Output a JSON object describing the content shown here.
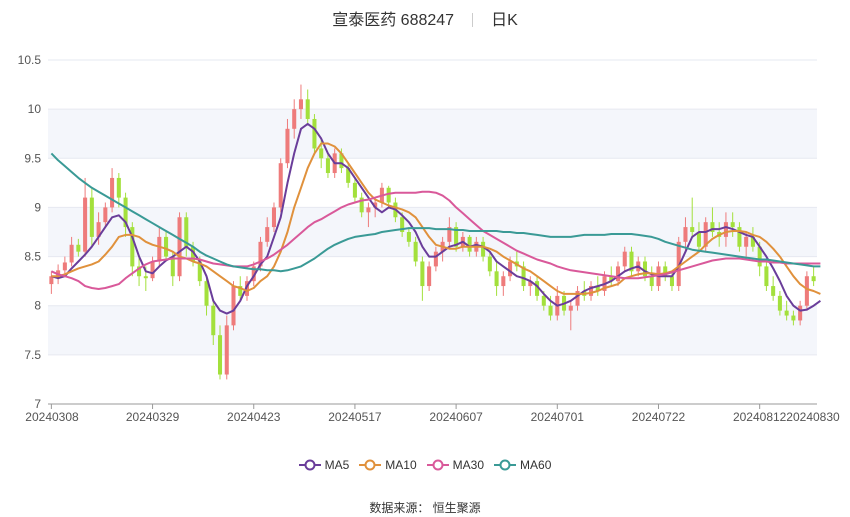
{
  "title": {
    "stock": "宣泰医药 688247",
    "period": "日K"
  },
  "source": "数据来源： 恒生聚源",
  "chart_data": {
    "type": "candlestick",
    "xlabels": [
      "20240308",
      "20240329",
      "20240423",
      "20240517",
      "20240607",
      "20240701",
      "20240722",
      "20240812",
      "20240830"
    ],
    "ylim": [
      7,
      10.5
    ],
    "yticks": [
      "7",
      "7.5",
      "8",
      "8.5",
      "9",
      "9.5",
      "10",
      "10.5"
    ],
    "grid": true,
    "legend_position": "bottom",
    "up_color": "#ee7b7b",
    "down_color": "#a3e03c",
    "dates": [
      "20240308",
      "20240311",
      "20240312",
      "20240313",
      "20240314",
      "20240315",
      "20240318",
      "20240319",
      "20240320",
      "20240321",
      "20240322",
      "20240325",
      "20240326",
      "20240327",
      "20240328",
      "20240329",
      "20240401",
      "20240402",
      "20240403",
      "20240408",
      "20240409",
      "20240410",
      "20240411",
      "20240412",
      "20240415",
      "20240416",
      "20240417",
      "20240418",
      "20240419",
      "20240422",
      "20240423",
      "20240424",
      "20240425",
      "20240426",
      "20240429",
      "20240430",
      "20240506",
      "20240507",
      "20240508",
      "20240509",
      "20240510",
      "20240513",
      "20240514",
      "20240515",
      "20240516",
      "20240517",
      "20240520",
      "20240521",
      "20240522",
      "20240523",
      "20240524",
      "20240527",
      "20240528",
      "20240529",
      "20240530",
      "20240531",
      "20240603",
      "20240604",
      "20240605",
      "20240606",
      "20240607",
      "20240611",
      "20240612",
      "20240613",
      "20240614",
      "20240617",
      "20240618",
      "20240619",
      "20240620",
      "20240621",
      "20240624",
      "20240625",
      "20240626",
      "20240627",
      "20240628",
      "20240701",
      "20240702",
      "20240703",
      "20240704",
      "20240705",
      "20240708",
      "20240709",
      "20240710",
      "20240711",
      "20240712",
      "20240715",
      "20240716",
      "20240717",
      "20240718",
      "20240719",
      "20240722",
      "20240723",
      "20240724",
      "20240725",
      "20240726",
      "20240729",
      "20240730",
      "20240731",
      "20240801",
      "20240802",
      "20240805",
      "20240806",
      "20240807",
      "20240808",
      "20240809",
      "20240812",
      "20240813",
      "20240814",
      "20240815",
      "20240816",
      "20240819",
      "20240820",
      "20240821",
      "20240822",
      "20240823",
      "20240826",
      "20240827",
      "20240828",
      "20240829",
      "20240830"
    ],
    "ohlc": [
      [
        8.22,
        8.35,
        8.12,
        8.3
      ],
      [
        8.3,
        8.42,
        8.22,
        8.36
      ],
      [
        8.36,
        8.5,
        8.3,
        8.44
      ],
      [
        8.44,
        8.7,
        8.4,
        8.62
      ],
      [
        8.62,
        8.68,
        8.5,
        8.55
      ],
      [
        8.55,
        9.3,
        8.5,
        9.1
      ],
      [
        9.1,
        9.2,
        8.6,
        8.7
      ],
      [
        8.7,
        8.95,
        8.62,
        8.85
      ],
      [
        8.85,
        9.05,
        8.8,
        9.0
      ],
      [
        9.0,
        9.4,
        8.95,
        9.3
      ],
      [
        9.3,
        9.35,
        9.0,
        9.1
      ],
      [
        9.1,
        9.15,
        8.7,
        8.8
      ],
      [
        8.8,
        8.85,
        8.3,
        8.4
      ],
      [
        8.4,
        8.5,
        8.2,
        8.3
      ],
      [
        8.3,
        8.4,
        8.15,
        8.28
      ],
      [
        8.28,
        8.5,
        8.25,
        8.45
      ],
      [
        8.45,
        8.8,
        8.4,
        8.7
      ],
      [
        8.7,
        8.75,
        8.45,
        8.5
      ],
      [
        8.5,
        8.55,
        8.2,
        8.3
      ],
      [
        8.3,
        8.95,
        8.25,
        8.9
      ],
      [
        8.9,
        8.95,
        8.5,
        8.6
      ],
      [
        8.6,
        8.65,
        8.4,
        8.45
      ],
      [
        8.45,
        8.5,
        8.2,
        8.25
      ],
      [
        8.25,
        8.3,
        7.9,
        8.0
      ],
      [
        8.0,
        8.05,
        7.6,
        7.7
      ],
      [
        7.7,
        7.8,
        7.25,
        7.3
      ],
      [
        7.3,
        7.9,
        7.25,
        7.8
      ],
      [
        7.8,
        8.25,
        7.75,
        8.2
      ],
      [
        8.2,
        8.3,
        8.05,
        8.1
      ],
      [
        8.1,
        8.3,
        8.05,
        8.25
      ],
      [
        8.25,
        8.45,
        8.2,
        8.4
      ],
      [
        8.4,
        8.7,
        8.35,
        8.65
      ],
      [
        8.65,
        8.9,
        8.6,
        8.8
      ],
      [
        8.8,
        9.05,
        8.75,
        9.0
      ],
      [
        9.0,
        9.5,
        8.95,
        9.45
      ],
      [
        9.45,
        9.9,
        9.4,
        9.8
      ],
      [
        9.8,
        10.1,
        9.7,
        10.0
      ],
      [
        10.0,
        10.25,
        9.9,
        10.1
      ],
      [
        10.1,
        10.2,
        9.85,
        9.9
      ],
      [
        9.9,
        9.95,
        9.55,
        9.6
      ],
      [
        9.6,
        9.7,
        9.4,
        9.5
      ],
      [
        9.5,
        9.55,
        9.3,
        9.35
      ],
      [
        9.35,
        9.6,
        9.3,
        9.55
      ],
      [
        9.55,
        9.6,
        9.35,
        9.4
      ],
      [
        9.4,
        9.45,
        9.2,
        9.25
      ],
      [
        9.25,
        9.3,
        9.05,
        9.1
      ],
      [
        9.1,
        9.15,
        8.9,
        8.95
      ],
      [
        8.95,
        9.05,
        8.8,
        9.0
      ],
      [
        9.0,
        9.1,
        8.9,
        9.05
      ],
      [
        9.05,
        9.25,
        9.0,
        9.2
      ],
      [
        9.2,
        9.22,
        9.0,
        9.05
      ],
      [
        9.05,
        9.1,
        8.85,
        8.9
      ],
      [
        8.9,
        8.95,
        8.7,
        8.75
      ],
      [
        8.75,
        8.8,
        8.6,
        8.65
      ],
      [
        8.65,
        8.7,
        8.4,
        8.45
      ],
      [
        8.45,
        8.5,
        8.05,
        8.2
      ],
      [
        8.2,
        8.45,
        8.15,
        8.4
      ],
      [
        8.4,
        8.6,
        8.35,
        8.55
      ],
      [
        8.55,
        8.7,
        8.45,
        8.65
      ],
      [
        8.65,
        8.9,
        8.6,
        8.8
      ],
      [
        8.8,
        8.85,
        8.55,
        8.6
      ],
      [
        8.6,
        8.75,
        8.55,
        8.7
      ],
      [
        8.7,
        8.72,
        8.5,
        8.55
      ],
      [
        8.55,
        8.7,
        8.5,
        8.65
      ],
      [
        8.65,
        8.7,
        8.45,
        8.5
      ],
      [
        8.5,
        8.55,
        8.3,
        8.35
      ],
      [
        8.35,
        8.45,
        8.1,
        8.2
      ],
      [
        8.2,
        8.35,
        8.1,
        8.3
      ],
      [
        8.3,
        8.5,
        8.25,
        8.45
      ],
      [
        8.45,
        8.55,
        8.35,
        8.4
      ],
      [
        8.4,
        8.45,
        8.15,
        8.2
      ],
      [
        8.2,
        8.3,
        8.1,
        8.25
      ],
      [
        8.25,
        8.3,
        8.05,
        8.1
      ],
      [
        8.1,
        8.15,
        7.95,
        8.0
      ],
      [
        8.0,
        8.1,
        7.85,
        7.9
      ],
      [
        7.9,
        8.2,
        7.85,
        8.1
      ],
      [
        8.1,
        8.15,
        7.9,
        7.95
      ],
      [
        7.95,
        8.05,
        7.75,
        8.0
      ],
      [
        8.0,
        8.2,
        7.95,
        8.15
      ],
      [
        8.15,
        8.25,
        8.05,
        8.1
      ],
      [
        8.1,
        8.25,
        8.05,
        8.2
      ],
      [
        8.2,
        8.3,
        8.1,
        8.15
      ],
      [
        8.15,
        8.35,
        8.1,
        8.3
      ],
      [
        8.3,
        8.4,
        8.2,
        8.25
      ],
      [
        8.25,
        8.45,
        8.2,
        8.4
      ],
      [
        8.4,
        8.6,
        8.35,
        8.55
      ],
      [
        8.55,
        8.6,
        8.3,
        8.35
      ],
      [
        8.35,
        8.5,
        8.3,
        8.45
      ],
      [
        8.45,
        8.5,
        8.25,
        8.3
      ],
      [
        8.3,
        8.4,
        8.15,
        8.2
      ],
      [
        8.2,
        8.45,
        8.15,
        8.4
      ],
      [
        8.4,
        8.45,
        8.25,
        8.3
      ],
      [
        8.3,
        8.35,
        8.15,
        8.2
      ],
      [
        8.2,
        8.7,
        8.15,
        8.65
      ],
      [
        8.65,
        8.9,
        8.55,
        8.8
      ],
      [
        8.8,
        9.1,
        8.7,
        8.75
      ],
      [
        8.75,
        8.85,
        8.55,
        8.6
      ],
      [
        8.6,
        8.9,
        8.55,
        8.85
      ],
      [
        8.85,
        9.0,
        8.7,
        8.75
      ],
      [
        8.75,
        8.85,
        8.6,
        8.7
      ],
      [
        8.7,
        8.95,
        8.6,
        8.85
      ],
      [
        8.85,
        8.95,
        8.7,
        8.8
      ],
      [
        8.8,
        8.85,
        8.55,
        8.6
      ],
      [
        8.6,
        8.75,
        8.5,
        8.7
      ],
      [
        8.7,
        8.8,
        8.55,
        8.6
      ],
      [
        8.6,
        8.65,
        8.3,
        8.4
      ],
      [
        8.4,
        8.45,
        8.15,
        8.2
      ],
      [
        8.2,
        8.3,
        8.05,
        8.1
      ],
      [
        8.1,
        8.15,
        7.9,
        7.95
      ],
      [
        7.95,
        8.05,
        7.85,
        7.9
      ],
      [
        7.9,
        7.95,
        7.8,
        7.85
      ],
      [
        7.85,
        8.05,
        7.8,
        8.0
      ],
      [
        8.0,
        8.35,
        7.95,
        8.3
      ],
      [
        8.3,
        8.4,
        8.2,
        8.25
      ]
    ],
    "series": [
      {
        "name": "MA5",
        "color": "#6a3d9a",
        "values": [
          8.3,
          8.28,
          8.3,
          8.38,
          8.45,
          8.52,
          8.6,
          8.7,
          8.8,
          8.9,
          8.92,
          8.85,
          8.7,
          8.5,
          8.35,
          8.33,
          8.4,
          8.46,
          8.5,
          8.55,
          8.6,
          8.55,
          8.45,
          8.3,
          8.05,
          7.95,
          7.92,
          7.95,
          8.05,
          8.2,
          8.3,
          8.42,
          8.5,
          8.7,
          8.9,
          9.25,
          9.55,
          9.8,
          9.85,
          9.8,
          9.7,
          9.55,
          9.45,
          9.45,
          9.4,
          9.3,
          9.2,
          9.1,
          9.0,
          8.95,
          9.0,
          8.98,
          8.92,
          8.85,
          8.75,
          8.6,
          8.5,
          8.5,
          8.55,
          8.6,
          8.62,
          8.65,
          8.6,
          8.62,
          8.6,
          8.55,
          8.45,
          8.4,
          8.35,
          8.3,
          8.28,
          8.25,
          8.2,
          8.12,
          8.05,
          8.0,
          8.02,
          8.05,
          8.1,
          8.15,
          8.18,
          8.2,
          8.22,
          8.25,
          8.3,
          8.35,
          8.38,
          8.4,
          8.35,
          8.32,
          8.3,
          8.3,
          8.3,
          8.4,
          8.55,
          8.7,
          8.75,
          8.75,
          8.78,
          8.78,
          8.8,
          8.78,
          8.75,
          8.72,
          8.7,
          8.6,
          8.5,
          8.38,
          8.25,
          8.1,
          8.0,
          7.95,
          7.96,
          8.0,
          8.05
        ]
      },
      {
        "name": "MA10",
        "color": "#e0913c",
        "values": [
          8.3,
          8.3,
          8.32,
          8.35,
          8.38,
          8.4,
          8.42,
          8.45,
          8.52,
          8.6,
          8.7,
          8.72,
          8.72,
          8.7,
          8.65,
          8.62,
          8.6,
          8.58,
          8.55,
          8.5,
          8.48,
          8.45,
          8.43,
          8.4,
          8.35,
          8.3,
          8.25,
          8.2,
          8.18,
          8.15,
          8.18,
          8.25,
          8.3,
          8.4,
          8.55,
          8.75,
          9.0,
          9.2,
          9.4,
          9.55,
          9.65,
          9.65,
          9.62,
          9.55,
          9.45,
          9.35,
          9.25,
          9.15,
          9.08,
          9.05,
          9.02,
          9.0,
          8.98,
          8.95,
          8.9,
          8.8,
          8.7,
          8.62,
          8.6,
          8.58,
          8.58,
          8.6,
          8.6,
          8.6,
          8.6,
          8.58,
          8.55,
          8.5,
          8.46,
          8.42,
          8.38,
          8.35,
          8.3,
          8.25,
          8.2,
          8.15,
          8.12,
          8.12,
          8.12,
          8.12,
          8.13,
          8.15,
          8.18,
          8.2,
          8.22,
          8.28,
          8.3,
          8.32,
          8.33,
          8.33,
          8.32,
          8.33,
          8.35,
          8.4,
          8.45,
          8.5,
          8.55,
          8.62,
          8.68,
          8.72,
          8.75,
          8.76,
          8.76,
          8.75,
          8.72,
          8.7,
          8.65,
          8.58,
          8.5,
          8.4,
          8.3,
          8.22,
          8.17,
          8.15,
          8.12
        ]
      },
      {
        "name": "MA30",
        "color": "#d9599a",
        "values": [
          8.35,
          8.32,
          8.3,
          8.28,
          8.25,
          8.2,
          8.18,
          8.17,
          8.18,
          8.2,
          8.22,
          8.28,
          8.33,
          8.38,
          8.42,
          8.45,
          8.46,
          8.47,
          8.48,
          8.48,
          8.48,
          8.48,
          8.47,
          8.45,
          8.43,
          8.42,
          8.41,
          8.4,
          8.4,
          8.4,
          8.42,
          8.45,
          8.48,
          8.52,
          8.57,
          8.62,
          8.68,
          8.74,
          8.8,
          8.85,
          8.88,
          8.92,
          8.96,
          9.0,
          9.03,
          9.05,
          9.07,
          9.08,
          9.1,
          9.12,
          9.14,
          9.15,
          9.15,
          9.15,
          9.15,
          9.16,
          9.16,
          9.15,
          9.12,
          9.07,
          9.0,
          8.94,
          8.88,
          8.82,
          8.76,
          8.72,
          8.68,
          8.64,
          8.6,
          8.56,
          8.53,
          8.5,
          8.47,
          8.45,
          8.43,
          8.4,
          8.38,
          8.36,
          8.35,
          8.34,
          8.33,
          8.32,
          8.31,
          8.3,
          8.29,
          8.28,
          8.28,
          8.28,
          8.29,
          8.3,
          8.31,
          8.32,
          8.34,
          8.36,
          8.38,
          8.4,
          8.42,
          8.44,
          8.46,
          8.47,
          8.48,
          8.48,
          8.48,
          8.47,
          8.46,
          8.45,
          8.45,
          8.44,
          8.44,
          8.43,
          8.43,
          8.43,
          8.43,
          8.43,
          8.43
        ]
      },
      {
        "name": "MA60",
        "color": "#3a9a96",
        "values": [
          9.55,
          9.48,
          9.42,
          9.36,
          9.3,
          9.25,
          9.2,
          9.16,
          9.12,
          9.08,
          9.04,
          9.0,
          8.96,
          8.92,
          8.88,
          8.84,
          8.8,
          8.76,
          8.72,
          8.68,
          8.64,
          8.6,
          8.55,
          8.51,
          8.48,
          8.45,
          8.42,
          8.4,
          8.39,
          8.38,
          8.37,
          8.37,
          8.36,
          8.36,
          8.35,
          8.36,
          8.38,
          8.4,
          8.44,
          8.48,
          8.53,
          8.58,
          8.62,
          8.65,
          8.68,
          8.7,
          8.71,
          8.72,
          8.73,
          8.75,
          8.76,
          8.77,
          8.78,
          8.79,
          8.79,
          8.79,
          8.79,
          8.78,
          8.78,
          8.78,
          8.77,
          8.77,
          8.76,
          8.76,
          8.76,
          8.76,
          8.76,
          8.75,
          8.75,
          8.74,
          8.74,
          8.73,
          8.72,
          8.71,
          8.7,
          8.7,
          8.7,
          8.7,
          8.71,
          8.72,
          8.72,
          8.72,
          8.72,
          8.73,
          8.73,
          8.73,
          8.73,
          8.72,
          8.71,
          8.7,
          8.68,
          8.65,
          8.63,
          8.61,
          8.59,
          8.57,
          8.56,
          8.55,
          8.54,
          8.53,
          8.52,
          8.51,
          8.5,
          8.49,
          8.48,
          8.47,
          8.47,
          8.46,
          8.45,
          8.44,
          8.43,
          8.42,
          8.41,
          8.4,
          8.4
        ]
      }
    ]
  }
}
